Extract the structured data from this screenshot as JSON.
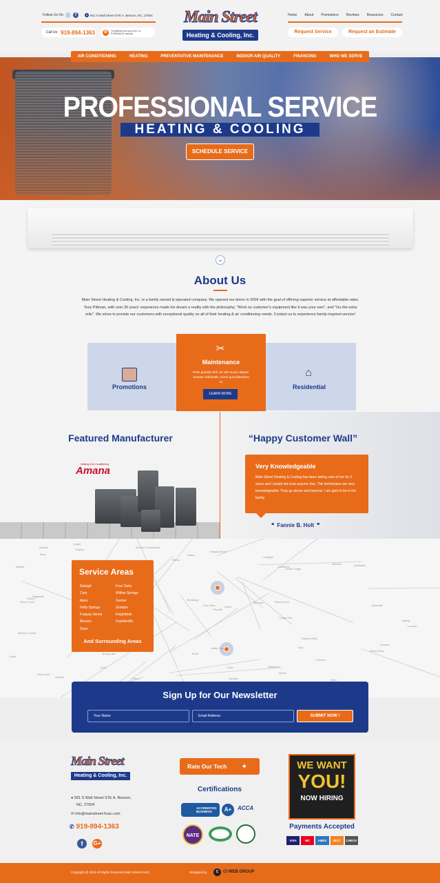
{
  "header": {
    "follow_label": "Follow Us On",
    "address": "501 S Wall Street STE A, Benson, NC, 27504",
    "call_label": "Call Us",
    "phone": "919-894-1363",
    "trouble_text": "Troubleshoot your AC or FURNACE Issues",
    "logo_top": "Main Street",
    "logo_bottom": "Heating & Cooling, Inc.",
    "top_nav": [
      "Home",
      "About",
      "Promotions",
      "Reviews",
      "Resources",
      "Contact"
    ],
    "request_service": "Request Service",
    "request_estimate": "Request an Estimate"
  },
  "main_nav": [
    "AIR CONDITIONING",
    "HEATING",
    "PREVENTATIVE MAINTENANCE",
    "INDOOR AIR QUALITY",
    "FINANCING",
    "WHO WE SERVE"
  ],
  "hero": {
    "title": "PROFESSIONAL SERVICE",
    "subtitle": "HEATING & COOLING",
    "cta": "SCHEDULE SERVICE"
  },
  "about": {
    "title": "About Us",
    "body": "Main Street Heating & Cooling, Inc. is a family owned & operated company. We opened our doors in 2009 with the goal of offering superior service at affordable rates. Tony Pittman, with over 30 years' experience made his dream a reality with the philosophy; \"Work on customer's equipment like it was your own\", and \"Go the extra mile\". We strive to provide our customers with exceptional quality on all of their heating & air conditioning needs. Contact us to experience family-inspired service!"
  },
  "cards": {
    "left_label": "Promotions",
    "center_title": "Maintenance",
    "center_text": "Proin gravida nibh vel velit auctor aliquet. Aenean sollicitudin, lorem quis bibendum ux",
    "center_button": "LEARN MORE",
    "right_label": "Residential"
  },
  "featured": {
    "title": "Featured Manufacturer",
    "brand_tag": "Heating & Air Conditioning",
    "brand": "Amana"
  },
  "wall": {
    "title": "“Happy Customer Wall”",
    "quote_title": "Very Knowledgeable",
    "quote_text": "Main Street Heating & Cooling has been taking care of me for 2 years and I would not trust anyone else. The technicians are very knowledgeable. They go above and beyond. I am glad to be in the family.",
    "author": "Fannie B. Holt"
  },
  "service_areas": {
    "title": "Service Areas",
    "col1": [
      "Raleigh",
      "Cary",
      "Apex",
      "Holly Springs",
      "Fuquay-Varina",
      "Benson",
      "Dunn"
    ],
    "col2": [
      "Four Oaks",
      "Willow Springs",
      "Garner",
      "Zebulon",
      "Knightdale",
      "Fayetteville"
    ],
    "footer": "And Surrounding Areas"
  },
  "map_labels": [
    "Raleigh",
    "Cary",
    "Garner",
    "Apex",
    "Clayton",
    "Benson",
    "Dunn",
    "Smithfield",
    "Fuquay-Varina",
    "Holly Springs",
    "Knightdale",
    "Zebulon",
    "Wendell",
    "Angier",
    "Lillington",
    "Selma",
    "Four Oaks",
    "Coats",
    "Erwin",
    "Kenly",
    "Wilson's Mills",
    "Princeton",
    "Pine Level",
    "Micro",
    "Newton Grove",
    "Spivey's Corner",
    "Broadway",
    "Sanford",
    "Linden",
    "Godwin",
    "Chapel Hill",
    "Durham",
    "Morrisville",
    "Rolesville",
    "Wake Forest",
    "Bunn",
    "Louisburg",
    "Middlesex",
    "Bailey",
    "Lucama",
    "Black Creek",
    "Fremont",
    "Pikeville",
    "Mount Olive",
    "Faison",
    "Dudley",
    "Goldsboro",
    "Archer Lodge",
    "Willow Spring",
    "McGee's Crossroads",
    "Kipling",
    "Buies Creek",
    "Olivia",
    "Spring Lake",
    "Falcon",
    "Stedman"
  ],
  "newsletter": {
    "title": "Sign Up for Our Newsletter",
    "name_placeholder": "Your Name",
    "email_placeholder": "Email Address",
    "submit": "SUBMIT NOW !"
  },
  "footer": {
    "address1": "501 S Wall Street STE A, Benson,",
    "address2": "NC, 27504",
    "email": "info@mainstreet-hvac.com",
    "phone": "919-894-1363",
    "rate_tech": "Rate Our Tech",
    "certifications": "Certifications",
    "bbb_text": "ACCREDITED BUSINESS",
    "bbb_rating": "A+",
    "acca": "ACCA",
    "nate": "NATE",
    "hiring1": "WE WANT",
    "hiring2": "YOU!",
    "hiring3": "NOW HIRING",
    "payments": "Payments Accepted",
    "cards": [
      "VISA",
      "MC",
      "AMEX",
      "DISC",
      "CHECK"
    ],
    "copyright": "Copyright @ 2018 All Rights Reserved Main Street HVAC",
    "designed_by": "Designed by:",
    "designer": "CI WEB GROUP"
  },
  "colors": {
    "orange": "#e86b1a",
    "blue": "#1d3a8a"
  }
}
